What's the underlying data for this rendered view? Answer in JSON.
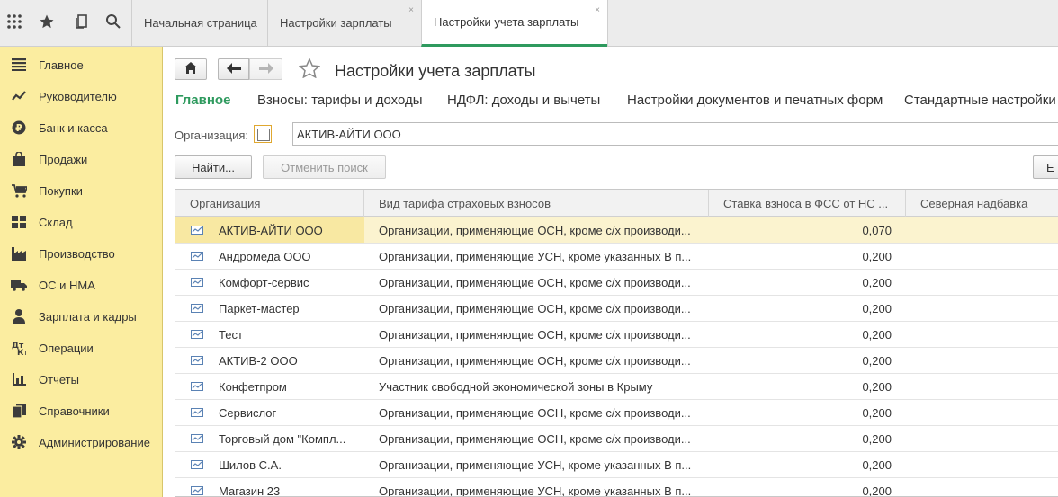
{
  "topbar": {
    "tools": [
      {
        "name": "apps-grid-icon"
      },
      {
        "name": "favorites-star-icon"
      },
      {
        "name": "history-icon"
      },
      {
        "name": "search-icon"
      }
    ],
    "tabs": [
      {
        "label": "Начальная страница",
        "active": false
      },
      {
        "label": "Настройки зарплаты",
        "active": false,
        "close": "×"
      },
      {
        "label": "Настройки учета зарплаты",
        "active": true,
        "close": "×"
      }
    ]
  },
  "sidebar": {
    "items": [
      {
        "label": "Главное",
        "icon": "menu-lines-icon"
      },
      {
        "label": "Руководителю",
        "icon": "trend-chart-icon"
      },
      {
        "label": "Банк и касса",
        "icon": "ruble-coin-icon"
      },
      {
        "label": "Продажи",
        "icon": "shopping-bag-icon"
      },
      {
        "label": "Покупки",
        "icon": "cart-icon"
      },
      {
        "label": "Склад",
        "icon": "warehouse-grid-icon"
      },
      {
        "label": "Производство",
        "icon": "factory-icon"
      },
      {
        "label": "ОС и НМА",
        "icon": "truck-icon"
      },
      {
        "label": "Зарплата и кадры",
        "icon": "person-icon"
      },
      {
        "label": "Операции",
        "icon": "debit-credit-icon"
      },
      {
        "label": "Отчеты",
        "icon": "bar-chart-icon"
      },
      {
        "label": "Справочники",
        "icon": "books-icon"
      },
      {
        "label": "Администрирование",
        "icon": "gear-icon"
      }
    ]
  },
  "main": {
    "title": "Настройки учета зарплаты",
    "subnav": [
      {
        "label": "Главное",
        "active": true
      },
      {
        "label": "Взносы: тарифы и доходы"
      },
      {
        "label": "НДФЛ: доходы и вычеты"
      },
      {
        "label": "Настройки документов и печатных форм"
      },
      {
        "label": "Стандартные настройки"
      }
    ],
    "org_label": "Организация:",
    "org_value": "АКТИВ-АЙТИ ООО",
    "find_button": "Найти...",
    "cancel_search_button": "Отменить поиск",
    "right_button": "Е"
  },
  "table": {
    "columns": [
      "Организация",
      "Вид тарифа страховых взносов",
      "Ставка взноса в ФСС от НС ...",
      "Северная надбавка"
    ],
    "rows": [
      {
        "org": "АКТИВ-АЙТИ ООО",
        "tariff": "Организации, применяющие ОСН, кроме с/х производи...",
        "rate": "0,070",
        "selected": true
      },
      {
        "org": "Андромеда ООО",
        "tariff": "Организации, применяющие УСН, кроме указанных В п...",
        "rate": "0,200"
      },
      {
        "org": "Комфорт-сервис",
        "tariff": "Организации, применяющие ОСН, кроме с/х производи...",
        "rate": "0,200"
      },
      {
        "org": "Паркет-мастер",
        "tariff": "Организации, применяющие ОСН, кроме с/х производи...",
        "rate": "0,200"
      },
      {
        "org": "Тест",
        "tariff": "Организации, применяющие ОСН, кроме с/х производи...",
        "rate": "0,200"
      },
      {
        "org": "АКТИВ-2 ООО",
        "tariff": "Организации, применяющие ОСН, кроме с/х производи...",
        "rate": "0,200"
      },
      {
        "org": "Конфетпром",
        "tariff": "Участник свободной экономической зоны в Крыму",
        "rate": "0,200"
      },
      {
        "org": "Сервислог",
        "tariff": "Организации, применяющие ОСН, кроме с/х производи...",
        "rate": "0,200"
      },
      {
        "org": "Торговый дом \"Компл...",
        "tariff": "Организации, применяющие ОСН, кроме с/х производи...",
        "rate": "0,200"
      },
      {
        "org": "Шилов С.А.",
        "tariff": "Организации, применяющие УСН, кроме указанных В п...",
        "rate": "0,200"
      },
      {
        "org": "Магазин 23",
        "tariff": "Организации, применяющие УСН, кроме указанных В п...",
        "rate": "0,200"
      }
    ]
  }
}
